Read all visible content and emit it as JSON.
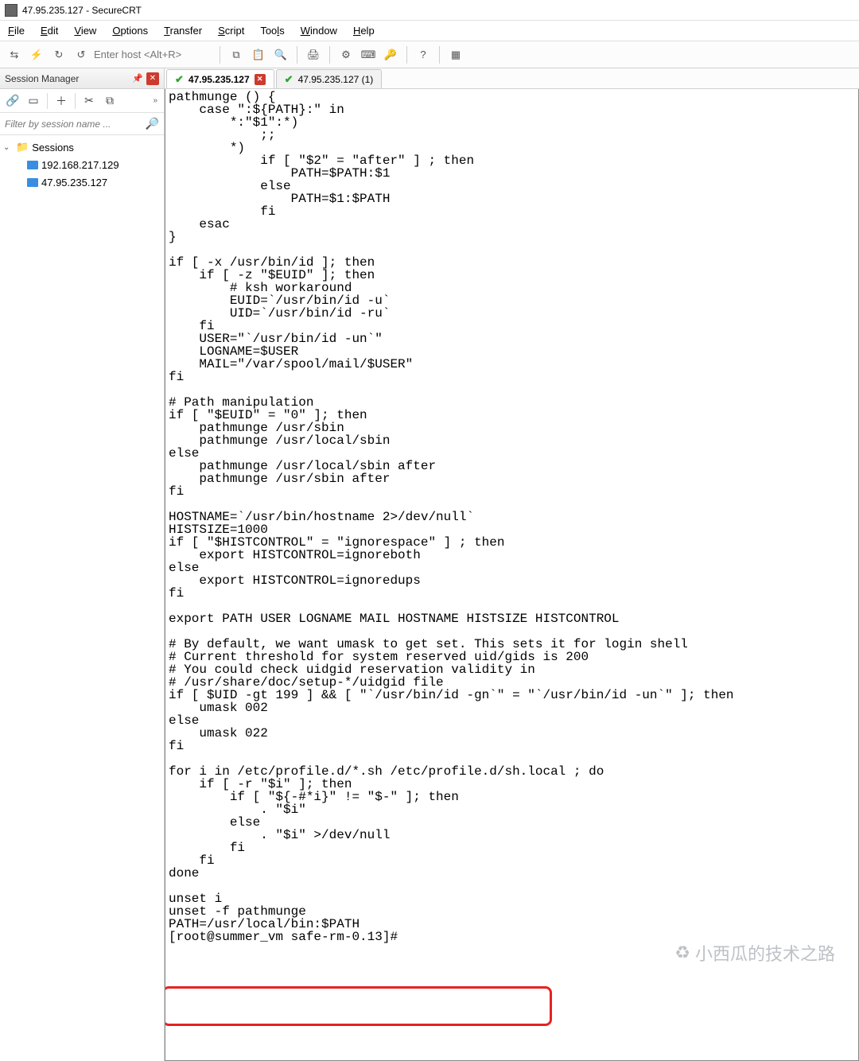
{
  "window": {
    "title": "47.95.235.127 - SecureCRT"
  },
  "menu": {
    "file": "File",
    "edit": "Edit",
    "view": "View",
    "options": "Options",
    "transfer": "Transfer",
    "script": "Script",
    "tools": "Tools",
    "window": "Window",
    "help": "Help"
  },
  "toolbar": {
    "host_placeholder": "Enter host <Alt+R>"
  },
  "session_manager": {
    "title": "Session Manager",
    "filter_placeholder": "Filter by session name ...",
    "root": "Sessions",
    "hosts": [
      "192.168.217.129",
      "47.95.235.127"
    ]
  },
  "tabs": {
    "active": "47.95.235.127",
    "inactive": "47.95.235.127 (1)"
  },
  "terminal_content": "pathmunge () {\n    case \":${PATH}:\" in\n        *:\"$1\":*)\n            ;;\n        *)\n            if [ \"$2\" = \"after\" ] ; then\n                PATH=$PATH:$1\n            else\n                PATH=$1:$PATH\n            fi\n    esac\n}\n\nif [ -x /usr/bin/id ]; then\n    if [ -z \"$EUID\" ]; then\n        # ksh workaround\n        EUID=`/usr/bin/id -u`\n        UID=`/usr/bin/id -ru`\n    fi\n    USER=\"`/usr/bin/id -un`\"\n    LOGNAME=$USER\n    MAIL=\"/var/spool/mail/$USER\"\nfi\n\n# Path manipulation\nif [ \"$EUID\" = \"0\" ]; then\n    pathmunge /usr/sbin\n    pathmunge /usr/local/sbin\nelse\n    pathmunge /usr/local/sbin after\n    pathmunge /usr/sbin after\nfi\n\nHOSTNAME=`/usr/bin/hostname 2>/dev/null`\nHISTSIZE=1000\nif [ \"$HISTCONTROL\" = \"ignorespace\" ] ; then\n    export HISTCONTROL=ignoreboth\nelse\n    export HISTCONTROL=ignoredups\nfi\n\nexport PATH USER LOGNAME MAIL HOSTNAME HISTSIZE HISTCONTROL\n\n# By default, we want umask to get set. This sets it for login shell\n# Current threshold for system reserved uid/gids is 200\n# You could check uidgid reservation validity in\n# /usr/share/doc/setup-*/uidgid file\nif [ $UID -gt 199 ] && [ \"`/usr/bin/id -gn`\" = \"`/usr/bin/id -un`\" ]; then\n    umask 002\nelse\n    umask 022\nfi\n\nfor i in /etc/profile.d/*.sh /etc/profile.d/sh.local ; do\n    if [ -r \"$i\" ]; then\n        if [ \"${-#*i}\" != \"$-\" ]; then\n            . \"$i\"\n        else\n            . \"$i\" >/dev/null\n        fi\n    fi\ndone\n\nunset i\nunset -f pathmunge\nPATH=/usr/local/bin:$PATH\n[root@summer_vm safe-rm-0.13]# ",
  "highlight": {
    "text1": "unset -f pathmunge",
    "text2": "PATH=/usr/local/bin:$PATH"
  },
  "watermark": "小西瓜的技术之路"
}
